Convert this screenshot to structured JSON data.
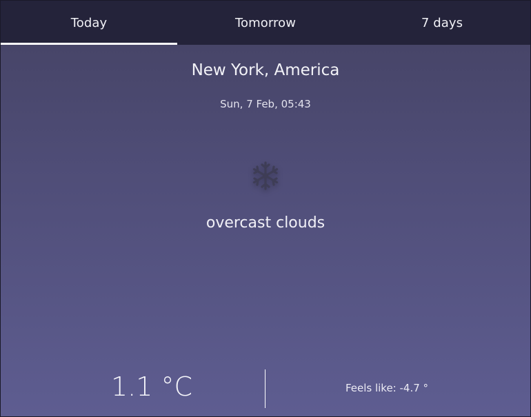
{
  "tabs": [
    {
      "label": "Today",
      "active": true
    },
    {
      "label": "Tomorrow",
      "active": false
    },
    {
      "label": "7 days",
      "active": false
    }
  ],
  "location": {
    "label": "New York, America"
  },
  "datetime": "Sun, 7 Feb, 05:43",
  "weather": {
    "icon": "snowflake-icon",
    "description": "overcast clouds",
    "temperature": "1.1 °C",
    "feels_like": "Feels like: -4.7 °"
  },
  "colors": {
    "tab_bar": "#24233a",
    "background_top": "#444263",
    "background_bottom": "#5e5d91",
    "icon": "#3e3d56",
    "text": "#ffffff"
  }
}
